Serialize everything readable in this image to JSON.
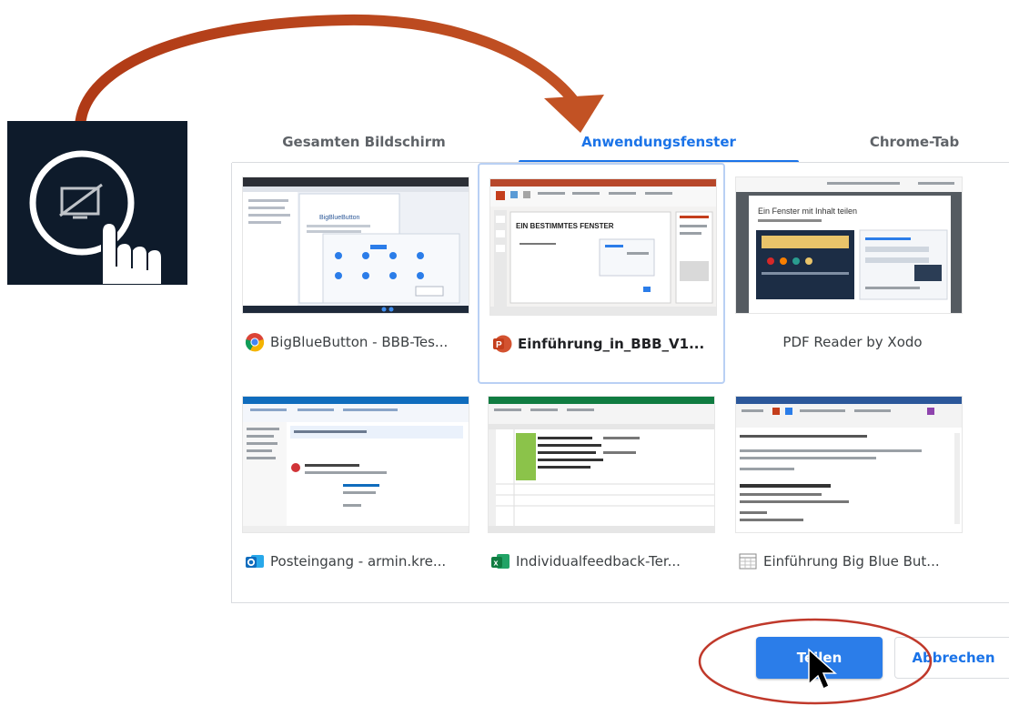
{
  "tabs": [
    {
      "label": "Gesamten Bildschirm",
      "active": false
    },
    {
      "label": "Anwendungsfenster",
      "active": true
    },
    {
      "label": "Chrome-Tab",
      "active": false
    }
  ],
  "windows": [
    {
      "label": "BigBlueButton - BBB-Tes...",
      "icon": "chrome-icon",
      "selected": false
    },
    {
      "label": "Einführung_in_BBB_V1...",
      "icon": "powerpoint-icon",
      "selected": true
    },
    {
      "label": "PDF Reader by Xodo",
      "icon": "",
      "selected": false
    },
    {
      "label": "Posteingang - armin.kre...",
      "icon": "outlook-icon",
      "selected": false
    },
    {
      "label": "Individualfeedback-Ter...",
      "icon": "excel-icon",
      "selected": false
    },
    {
      "label": "Einführung Big Blue But...",
      "icon": "document-icon",
      "selected": false
    }
  ],
  "thumbnails": {
    "pdf_heading": "Ein Fenster mit Inhalt teilen",
    "ppt_heading": "EIN BESTIMMTES FENSTER",
    "bbb_heading": "BigBlueButton"
  },
  "buttons": {
    "share": "Teilen",
    "cancel": "Abbrechen"
  },
  "colors": {
    "accent": "#1a73e8",
    "annotation": "#c0392b",
    "arrow": "#b5451b",
    "panel": "#0e1b2b"
  }
}
